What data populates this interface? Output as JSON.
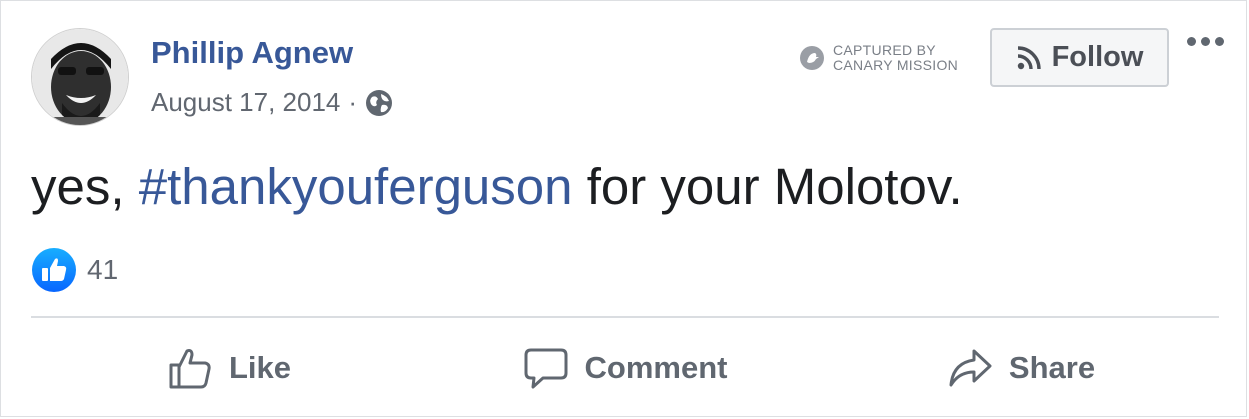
{
  "post": {
    "author": "Phillip Agnew",
    "date": "August 17, 2014",
    "separator": "·",
    "audience_icon": "globe-icon",
    "captured_line1": "CAPTURED BY",
    "captured_line2": "CANARY MISSION",
    "follow_label": "Follow",
    "text_before": "yes, ",
    "hashtag": "#thankyouferguson",
    "text_after": " for your Molotov.",
    "like_count": "41"
  },
  "actions": {
    "like": "Like",
    "comment": "Comment",
    "share": "Share"
  },
  "colors": {
    "link": "#385898",
    "like_blue": "#1877f2",
    "text": "#1c1e21",
    "muted": "#606770"
  }
}
